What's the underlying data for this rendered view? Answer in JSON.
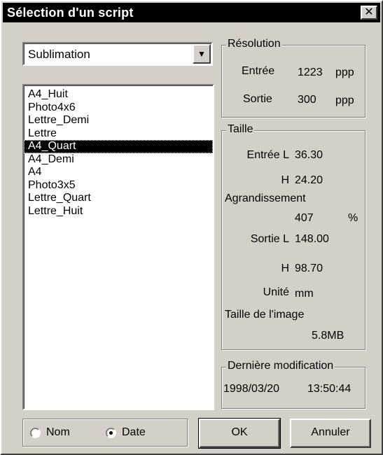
{
  "window": {
    "title": "Sélection d'un script",
    "close_glyph": "✕"
  },
  "combo": {
    "value": "Sublimation",
    "arrow_glyph": "▼"
  },
  "list": {
    "items": [
      "A4_Huit",
      "Photo4x6",
      "Lettre_Demi",
      "Lettre",
      "A4_Quart",
      "A4_Demi",
      "A4",
      "Photo3x5",
      "Lettre_Quart",
      "Lettre_Huit"
    ],
    "selected": "A4_Quart"
  },
  "resolution": {
    "title": "Résolution",
    "input_label": "Entrée",
    "input_value": "1223",
    "input_unit": "ppp",
    "output_label": "Sortie",
    "output_value": "300",
    "output_unit": "ppp"
  },
  "size": {
    "title": "Taille",
    "input_w_label": "Entrée L",
    "input_w_value": "36.30",
    "input_h_label": "H",
    "input_h_value": "24.20",
    "enlargement_label": "Agrandissement",
    "enlargement_value": "407",
    "enlargement_unit": "%",
    "output_w_label": "Sortie L",
    "output_w_value": "148.00",
    "output_h_label": "H",
    "output_h_value": "98.70",
    "unit_label": "Unité",
    "unit_value": "mm",
    "image_size_label": "Taille de l'image",
    "image_size_value": "5.8MB"
  },
  "last_modified": {
    "title": "Dernière modification",
    "date": "1998/03/20",
    "time": "13:50:44"
  },
  "sort": {
    "name_label": "Nom",
    "date_label": "Date",
    "selected": "Date"
  },
  "buttons": {
    "ok": "OK",
    "cancel": "Annuler"
  }
}
